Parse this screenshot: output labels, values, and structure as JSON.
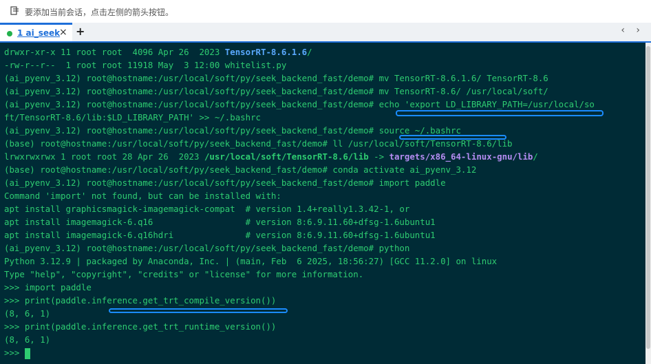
{
  "topbar": {
    "hint": "要添加当前会话，点击左侧的箭头按钮。"
  },
  "tabs": [
    {
      "label": "1 ai_seek",
      "close": "×",
      "status_color": "#22b14c"
    }
  ],
  "tabbar": {
    "add": "+",
    "nav": "‹ ›"
  },
  "terminal": {
    "lines": {
      "l0a": "drwxr-xr-x 11 root root  4096 Apr 26  2023 ",
      "l0b": "TensorRT-8.6.1.6",
      "l0c": "/",
      "l1": "-rw-r--r--  1 root root 11918 May  3 12:00 whitelist.py",
      "l2": "(ai_pyenv_3.12) root@hostname:/usr/local/soft/py/seek_backend_fast/demo# mv TensorRT-8.6.1.6/ TensorRT-8.6",
      "l3": "(ai_pyenv_3.12) root@hostname:/usr/local/soft/py/seek_backend_fast/demo# mv TensorRT-8.6/ /usr/local/soft/",
      "l4": "(ai_pyenv_3.12) root@hostname:/usr/local/soft/py/seek_backend_fast/demo# echo 'export LD_LIBRARY_PATH=/usr/local/so",
      "l5": "ft/TensorRT-8.6/lib:$LD_LIBRARY_PATH' >> ~/.bashrc",
      "l6": "(ai_pyenv_3.12) root@hostname:/usr/local/soft/py/seek_backend_fast/demo# source ~/.bashrc",
      "l7": "(base) root@hostname:/usr/local/soft/py/seek_backend_fast/demo# ll /usr/local/soft/TensorRT-8.6/lib",
      "l8a": "lrwxrwxrwx 1 root root 28 Apr 26  2023 ",
      "l8b": "/usr/local/soft/TensorRT-8.6/lib",
      "l8c": " -> ",
      "l8d": "targets/x86_64-linux-gnu/lib",
      "l8e": "/",
      "l9": "(base) root@hostname:/usr/local/soft/py/seek_backend_fast/demo# conda activate ai_pyenv_3.12",
      "l10": "(ai_pyenv_3.12) root@hostname:/usr/local/soft/py/seek_backend_fast/demo# import paddle",
      "l11": "Command 'import' not found, but can be installed with:",
      "l12": "apt install graphicsmagick-imagemagick-compat  # version 1.4+really1.3.42-1, or",
      "l13": "apt install imagemagick-6.q16                  # version 8:6.9.11.60+dfsg-1.6ubuntu1",
      "l14": "apt install imagemagick-6.q16hdri              # version 8:6.9.11.60+dfsg-1.6ubuntu1",
      "l15": "(ai_pyenv_3.12) root@hostname:/usr/local/soft/py/seek_backend_fast/demo# python",
      "l16": "Python 3.12.9 | packaged by Anaconda, Inc. | (main, Feb  6 2025, 18:56:27) [GCC 11.2.0] on linux",
      "l17": "Type \"help\", \"copyright\", \"credits\" or \"license\" for more information.",
      "l18": ">>> import paddle",
      "l19": ">>> print(paddle.inference.get_trt_compile_version())",
      "l20": "(8, 6, 1)",
      "l21": ">>> print(paddle.inference.get_trt_runtime_version())",
      "l22": "(8, 6, 1)",
      "l23": ">>> "
    }
  },
  "colors": {
    "terminal_bg": "#002b36",
    "terminal_text": "#2ecc71",
    "dir_highlight": "#5aa9ff",
    "link_target": "#b58cf2",
    "annotation": "#1a8cff",
    "tab_accent": "#1e6fd9"
  }
}
